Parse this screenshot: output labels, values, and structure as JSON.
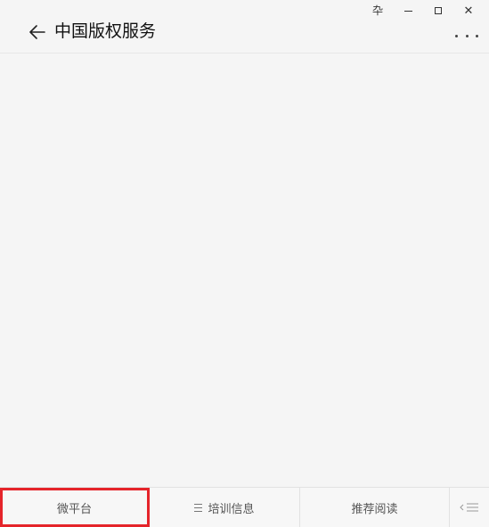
{
  "window": {
    "pin_icon": "pin-icon",
    "minimize_icon": "minimize-icon",
    "maximize_icon": "maximize-icon",
    "close_icon": "close-icon"
  },
  "header": {
    "title": "中国版权服务",
    "back_icon": "back-arrow-icon",
    "more_icon": "more-icon"
  },
  "bottom_menu": {
    "items": [
      {
        "label": "微平台",
        "has_submenu": false,
        "selected": true
      },
      {
        "label": "培训信息",
        "has_submenu": true,
        "selected": false
      },
      {
        "label": "推荐阅读",
        "has_submenu": false,
        "selected": false
      }
    ],
    "keyboard_icon": "switch-to-keyboard-icon",
    "highlight_color": "#e5242a"
  }
}
